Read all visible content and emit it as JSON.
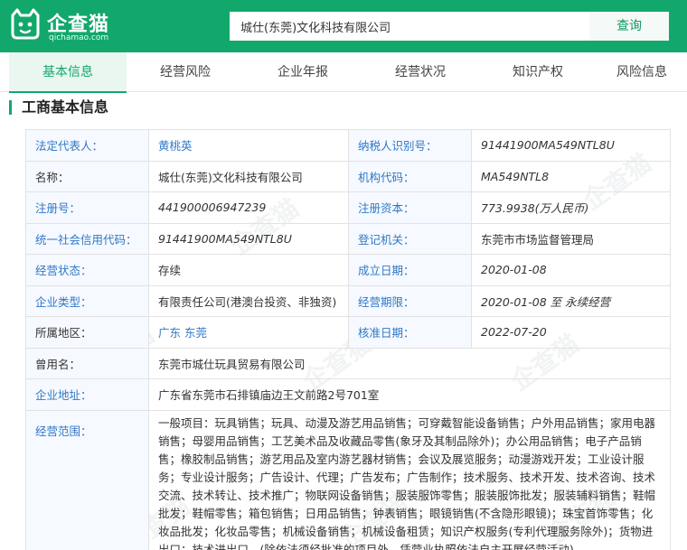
{
  "header": {
    "logo_text": "企查猫",
    "logo_sub": "qichamao.com",
    "search_value": "城仕(东莞)文化科技有限公司",
    "search_button": "查询"
  },
  "tabs": [
    "基本信息",
    "经营风险",
    "企业年报",
    "经营状况",
    "知识产权",
    "风险信息"
  ],
  "section_title": "工商基本信息",
  "watermark": "企查猫",
  "fields": {
    "legal_rep_label": "法定代表人：",
    "legal_rep": "黄桃英",
    "taxpayer_id_label": "纳税人识别号：",
    "taxpayer_id": "91441900MA549NTL8U",
    "name_label": "名称：",
    "name": "城仕(东莞)文化科技有限公司",
    "org_code_label": "机构代码：",
    "org_code": "MA549NTL8",
    "reg_no_label": "注册号：",
    "reg_no": "441900006947239",
    "reg_capital_label": "注册资本：",
    "reg_capital": "773.9938(万人民币)",
    "credit_code_label": "统一社会信用代码：",
    "credit_code": "91441900MA549NTL8U",
    "authority_label": "登记机关：",
    "authority": "东莞市市场监督管理局",
    "status_label": "经营状态：",
    "status": "存续",
    "established_label": "成立日期：",
    "established": "2020-01-08",
    "type_label": "企业类型：",
    "type": "有限责任公司(港澳台投资、非独资)",
    "term_label": "经营期限：",
    "term": "2020-01-08 至 永续经营",
    "region_label": "所属地区：",
    "region": "广东 东莞",
    "approval_label": "核准日期：",
    "approval": "2022-07-20",
    "former_name_label": "曾用名：",
    "former_name": "东莞市城仕玩具贸易有限公司",
    "address_label": "企业地址：",
    "address": "广东省东莞市石排镇庙边王文前路2号701室",
    "scope_label": "经营范围：",
    "scope": "一般项目：玩具销售；玩具、动漫及游艺用品销售；可穿戴智能设备销售；户外用品销售；家用电器销售；母婴用品销售；工艺美术品及收藏品零售(象牙及其制品除外)；办公用品销售；电子产品销售；橡胶制品销售；游艺用品及室内游艺器材销售；会议及展览服务；动漫游戏开发；工业设计服务；专业设计服务；广告设计、代理；广告发布；广告制作；技术服务、技术开发、技术咨询、技术交流、技术转让、技术推广；物联网设备销售；服装服饰零售；服装服饰批发；服装辅料销售；鞋帽批发；鞋帽零售；箱包销售；日用品销售；钟表销售；眼镜销售(不含隐形眼镜)；珠宝首饰零售；化妆品批发；化妆品零售；机械设备销售；机械设备租赁；知识产权服务(专利代理服务除外)；货物进出口；技术进出口。(除依法须经批准的项目外，凭营业执照依法自主开展经营活动)"
  }
}
